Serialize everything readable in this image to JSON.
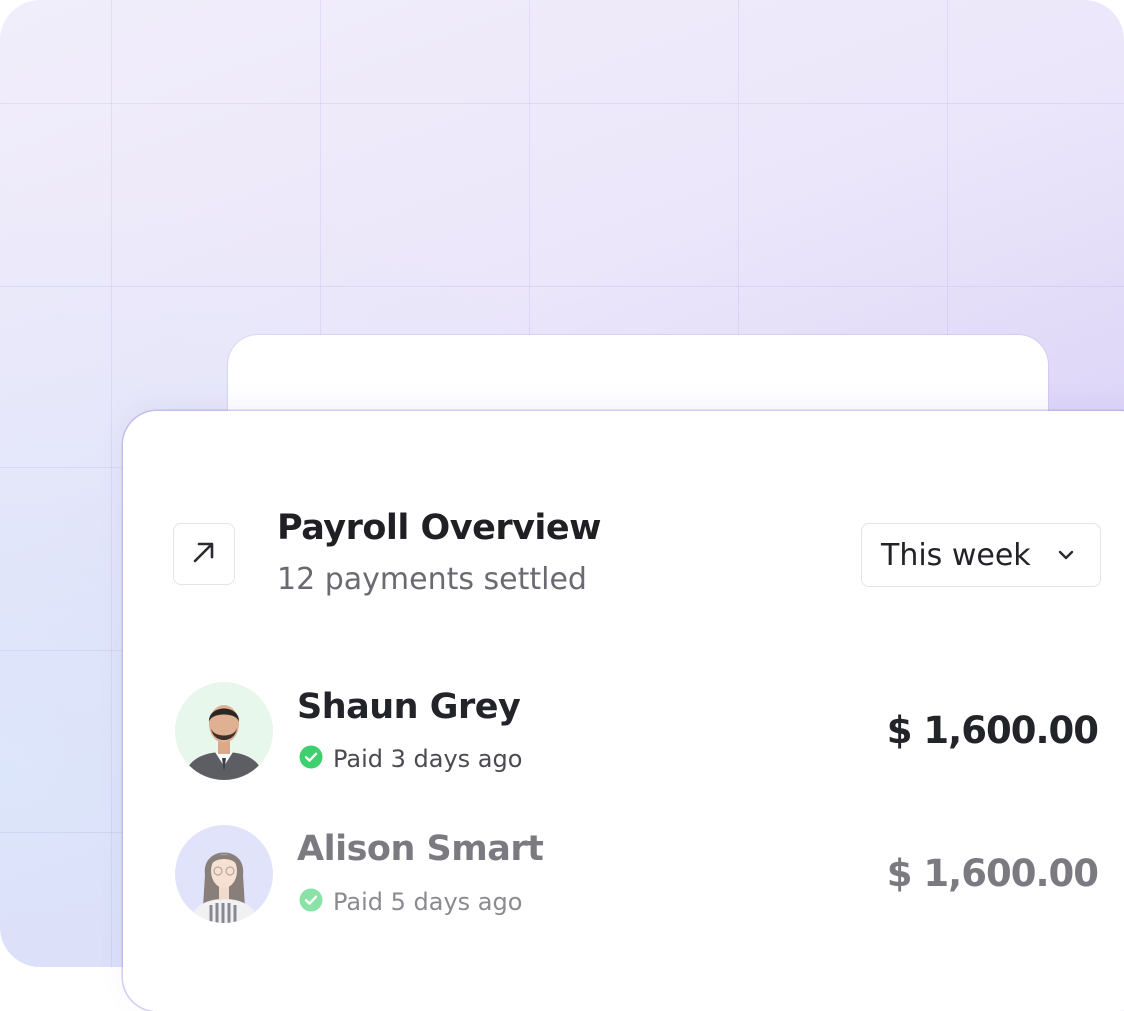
{
  "card": {
    "title": "Payroll Overview",
    "subtitle": "12 payments settled",
    "period": "This week"
  },
  "payments": [
    {
      "name": "Shaun Grey",
      "status": "Paid 3 days ago",
      "amount": "$ 1,600.00",
      "avatar_bg": "#e8f7ec"
    },
    {
      "name": "Alison Smart",
      "status": "Paid 5 days ago",
      "amount": "$ 1,600.00",
      "avatar_bg": "#cdd2f7"
    }
  ],
  "icons": {
    "expand": "arrow-up-right-icon",
    "dropdown": "chevron-down-icon",
    "paid": "check-circle-icon"
  },
  "colors": {
    "accent_purple": "#d8d2f6",
    "paid_green": "#3ecf6e"
  }
}
